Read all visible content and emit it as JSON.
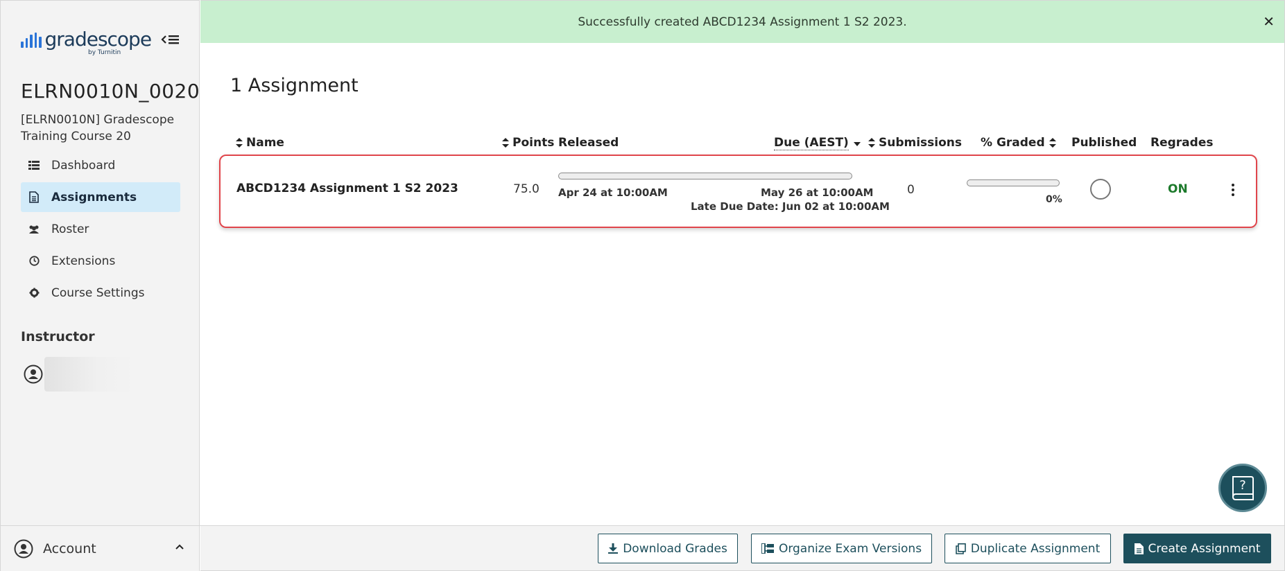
{
  "brand": {
    "name": "gradescope",
    "sub": "by Turnitin",
    "bar_color": "#2a74d8"
  },
  "course": {
    "code": "ELRN0010N_0020",
    "name": "[ELRN0010N] Gradescope Training Course 20"
  },
  "nav": [
    {
      "label": "Dashboard",
      "icon": "dashboard-icon"
    },
    {
      "label": "Assignments",
      "icon": "document-icon",
      "active": true
    },
    {
      "label": "Roster",
      "icon": "users-icon"
    },
    {
      "label": "Extensions",
      "icon": "clock-icon"
    },
    {
      "label": "Course Settings",
      "icon": "gear-icon"
    }
  ],
  "instructor": {
    "heading": "Instructor"
  },
  "account": {
    "label": "Account"
  },
  "banner": {
    "message": "Successfully created ABCD1234 Assignment 1 S2 2023.",
    "color": "#c8efcf"
  },
  "page": {
    "title": "1 Assignment"
  },
  "table": {
    "headers": {
      "name": "Name",
      "points": "Points",
      "released": "Released",
      "due": "Due (AEST)",
      "submissions": "Submissions",
      "graded": "% Graded",
      "published": "Published",
      "regrades": "Regrades"
    },
    "rows": [
      {
        "name": "ABCD1234 Assignment 1 S2 2023",
        "points": "75.0",
        "released": "Apr 24 at 10:00AM",
        "due": "May 26 at 10:00AM",
        "late_due": "Late Due Date: Jun 02 at 10:00AM",
        "submissions": "0",
        "graded_pct": "0%",
        "graded_fraction": 0,
        "published": false,
        "regrades": "ON"
      }
    ]
  },
  "footer": {
    "download": "Download Grades",
    "organize": "Organize Exam Versions",
    "duplicate": "Duplicate Assignment",
    "create": "Create Assignment"
  },
  "colors": {
    "accent": "#1d4f5c",
    "regrades_on": "#1d7a2c",
    "highlight_border": "#e0454b",
    "active_nav": "#d2ebf9"
  }
}
